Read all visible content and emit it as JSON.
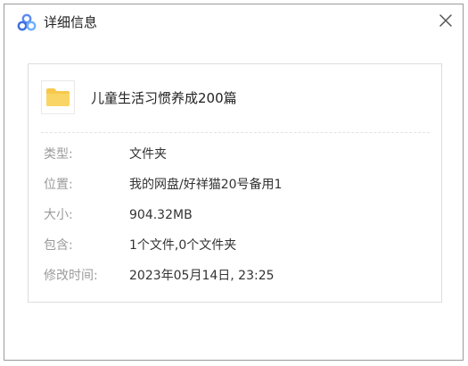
{
  "dialog": {
    "title": "详细信息",
    "colors": {
      "accent": "#5b8cf2",
      "folder": "#f6c94c",
      "label": "#9b9b9b"
    }
  },
  "file": {
    "name": "儿童生活习惯养成200篇",
    "icon": "folder-icon"
  },
  "details": [
    {
      "label": "类型:",
      "value": "文件夹"
    },
    {
      "label": "位置:",
      "value": "我的网盘/好祥猫20号备用1"
    },
    {
      "label": "大小:",
      "value": "904.32MB"
    },
    {
      "label": "包含:",
      "value": "1个文件,0个文件夹"
    },
    {
      "label": "修改时间:",
      "value": "2023年05月14日, 23:25"
    }
  ]
}
